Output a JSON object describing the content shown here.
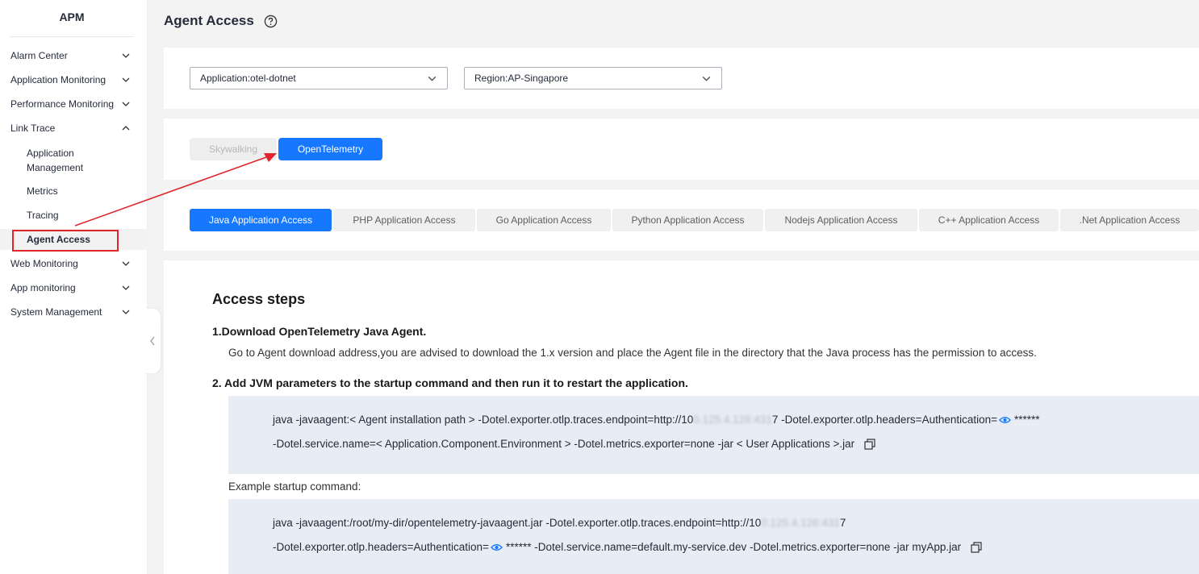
{
  "sidebar": {
    "title": "APM",
    "items": [
      {
        "label": "Alarm Center",
        "chevron": "down"
      },
      {
        "label": "Application Monitoring",
        "chevron": "down"
      },
      {
        "label": "Performance Monitoring",
        "chevron": "down"
      },
      {
        "label": "Link Trace",
        "chevron": "up"
      },
      {
        "label": "Application Management",
        "sub": true
      },
      {
        "label": "Metrics",
        "sub": true
      },
      {
        "label": "Tracing",
        "sub": true
      },
      {
        "label": "Agent Access",
        "sub": true,
        "active": true
      },
      {
        "label": "Web Monitoring",
        "chevron": "down"
      },
      {
        "label": "App monitoring",
        "chevron": "down"
      },
      {
        "label": "System Management",
        "chevron": "down"
      }
    ]
  },
  "header": {
    "title": "Agent Access"
  },
  "filters": {
    "application": "Application:otel-dotnet",
    "region": "Region:AP-Singapore"
  },
  "protocols": {
    "skywalking": "Skywalking",
    "opentelemetry": "OpenTelemetry",
    "selected": "OpenTelemetry"
  },
  "languages": {
    "tabs": [
      {
        "label": "Java Application Access",
        "active": true
      },
      {
        "label": "PHP Application Access"
      },
      {
        "label": "Go Application Access"
      },
      {
        "label": "Python Application Access"
      },
      {
        "label": "Nodejs Application Access"
      },
      {
        "label": "C++ Application Access"
      },
      {
        "label": ".Net Application Access"
      }
    ]
  },
  "content": {
    "heading": "Access steps",
    "step1_title": "1.Download OpenTelemetry Java Agent.",
    "step1_text": "Go to Agent download address,you are advised to download the 1.x version and place the Agent file in the directory that the Java process has the permission to access.",
    "step2_title": "2. Add JVM parameters to the startup command and then run it to restart the application.",
    "cmd1_line1_a": "java -javaagent:< Agent installation path > -Dotel.exporter.otlp.traces.endpoint=http://10",
    "cmd1_line1_blur": "0.125.4.126:431",
    "cmd1_line1_b": "7 -Dotel.exporter.otlp.headers=Authentication=",
    "cmd1_line1_mask": "******",
    "cmd1_line2": "-Dotel.service.name=< Application.Component.Environment > -Dotel.metrics.exporter=none -jar < User Applications >.jar",
    "example_label": "Example startup command:",
    "cmd2_line1_a": "java -javaagent:/root/my-dir/opentelemetry-javaagent.jar -Dotel.exporter.otlp.traces.endpoint=http://10",
    "cmd2_line1_blur": "0.125.4.126:431",
    "cmd2_line1_b": "7",
    "cmd2_line2_a": "-Dotel.exporter.otlp.headers=Authentication=",
    "cmd2_line2_mask": "******",
    "cmd2_line2_b": " -Dotel.service.name=default.my-service.dev -Dotel.metrics.exporter=none -jar myApp.jar"
  },
  "colors": {
    "accent": "#1677ff",
    "annotation": "#e0262c",
    "code_bg": "#e8ecf5"
  },
  "icons": [
    "help-icon",
    "chevron-down-icon",
    "chevron-up-icon",
    "collapse-left-icon",
    "eye-icon",
    "copy-icon"
  ]
}
